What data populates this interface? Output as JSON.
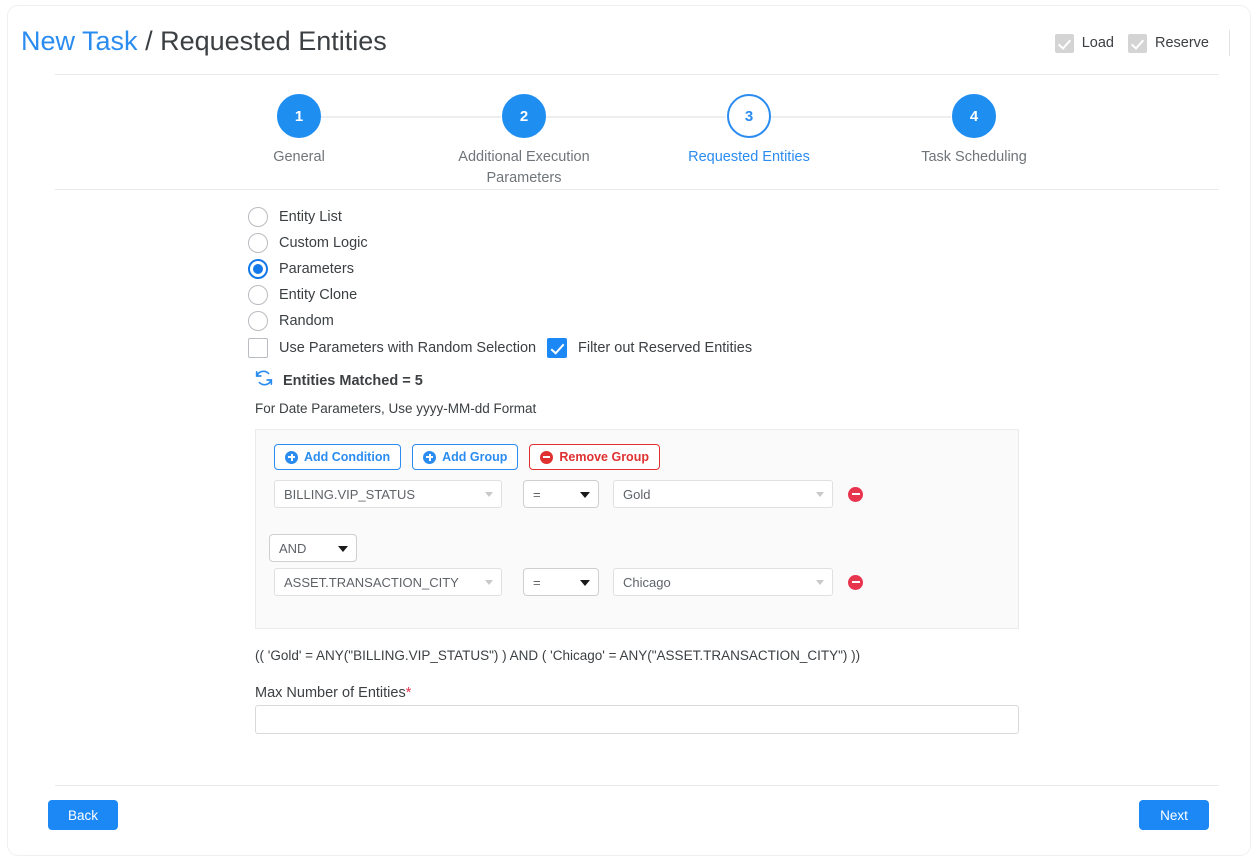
{
  "header": {
    "breadcrumb_link": "New Task",
    "breadcrumb_separator": "/",
    "breadcrumb_current": "Requested Entities",
    "checks": [
      {
        "label": "Load",
        "checked": true,
        "disabled": true,
        "icon": "checkbox-checked-disabled-icon"
      },
      {
        "label": "Reserve",
        "checked": true,
        "disabled": true,
        "icon": "checkbox-checked-disabled-icon"
      }
    ]
  },
  "stepper": {
    "steps": [
      {
        "number": "1",
        "label": "General",
        "state": "done"
      },
      {
        "number": "2",
        "label": "Additional Execution Parameters",
        "state": "done"
      },
      {
        "number": "3",
        "label": "Requested Entities",
        "state": "active"
      },
      {
        "number": "4",
        "label": "Task Scheduling",
        "state": "done"
      }
    ]
  },
  "selection_mode": {
    "options": [
      {
        "label": "Entity List",
        "selected": false
      },
      {
        "label": "Custom Logic",
        "selected": false
      },
      {
        "label": "Parameters",
        "selected": true
      },
      {
        "label": "Entity Clone",
        "selected": false
      },
      {
        "label": "Random",
        "selected": false
      }
    ],
    "use_parameters_random": {
      "label": "Use Parameters with Random Selection",
      "checked": false
    },
    "filter_reserved": {
      "label": "Filter out Reserved Entities",
      "checked": true
    }
  },
  "matched": {
    "refresh_icon": "refresh-icon",
    "text": "Entities Matched = 5"
  },
  "date_hint": "For Date Parameters, Use yyyy-MM-dd Format",
  "condition_group": {
    "buttons": [
      {
        "label": "Add Condition",
        "icon": "plus-circle-icon",
        "style": "blue"
      },
      {
        "label": "Add Group",
        "icon": "plus-circle-icon",
        "style": "blue"
      },
      {
        "label": "Remove Group",
        "icon": "minus-circle-icon",
        "style": "red"
      }
    ],
    "logic_operator": "AND",
    "conditions": [
      {
        "field": "BILLING.VIP_STATUS",
        "operator": "=",
        "value": "Gold",
        "remove_icon": "remove-condition-icon"
      },
      {
        "field": "ASSET.TRANSACTION_CITY",
        "operator": "=",
        "value": "Chicago",
        "remove_icon": "remove-condition-icon"
      }
    ]
  },
  "expression": "(( 'Gold' = ANY(\"BILLING.VIP_STATUS\") ) AND ( 'Chicago' = ANY(\"ASSET.TRANSACTION_CITY\") ))",
  "max_entities": {
    "label": "Max Number of Entities",
    "required_marker": "*",
    "value": "",
    "placeholder": ""
  },
  "footer": {
    "back_label": "Back",
    "next_label": "Next"
  },
  "colors": {
    "accent_blue": "#1b88f5",
    "link_blue": "#2b8cf0",
    "danger_red": "#e8354e",
    "panel_bg": "#fafafa"
  }
}
